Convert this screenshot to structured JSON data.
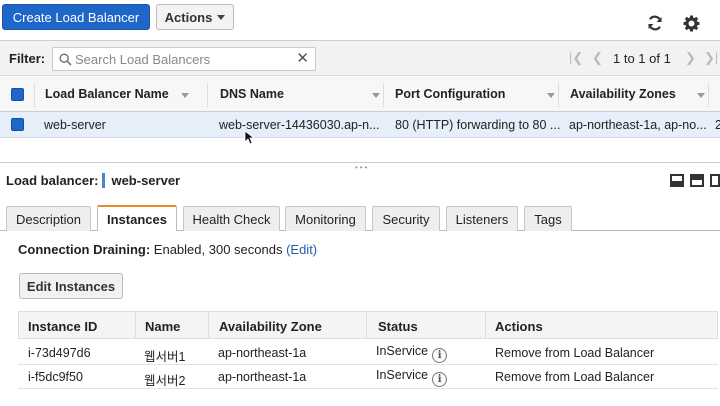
{
  "toolbar": {
    "create_label": "Create Load Balancer",
    "actions_label": "Actions",
    "refresh_icon": "refresh-icon",
    "settings_icon": "gear-icon"
  },
  "filter": {
    "label": "Filter:",
    "placeholder": "Search Load Balancers",
    "value": "",
    "pagination": "1 to 1 of 1"
  },
  "table": {
    "columns": [
      "Load Balancer Name",
      "DNS Name",
      "Port Configuration",
      "Availability Zones"
    ],
    "rows": [
      {
        "name": "web-server",
        "dns": "web-server-14436030.ap-n...",
        "port": "80 (HTTP) forwarding to 80 ...",
        "zones": "ap-northeast-1a, ap-no...",
        "extra": "2",
        "selected": true
      }
    ]
  },
  "detail": {
    "label": "Load balancer:",
    "name": "web-server",
    "tabs": [
      "Description",
      "Instances",
      "Health Check",
      "Monitoring",
      "Security",
      "Listeners",
      "Tags"
    ],
    "active_tab": "Instances",
    "draining_label": "Connection Draining:",
    "draining_value": "Enabled, 300 seconds",
    "draining_edit": "(Edit)",
    "edit_instances_label": "Edit Instances",
    "instance_columns": [
      "Instance ID",
      "Name",
      "Availability Zone",
      "Status",
      "Actions"
    ],
    "instances": [
      {
        "id": "i-73d497d6",
        "name": "웹서버1",
        "zone": "ap-northeast-1a",
        "status": "InService",
        "action": "Remove from Load Balancer"
      },
      {
        "id": "i-f5dc9f50",
        "name": "웹서버2",
        "zone": "ap-northeast-1a",
        "status": "InService",
        "action": "Remove from Load Balancer"
      }
    ]
  },
  "colors": {
    "primary": "#1f66c9",
    "link": "#1b5fa8",
    "selected_row": "#e6eef9",
    "active_tab_accent": "#e98a2b"
  }
}
